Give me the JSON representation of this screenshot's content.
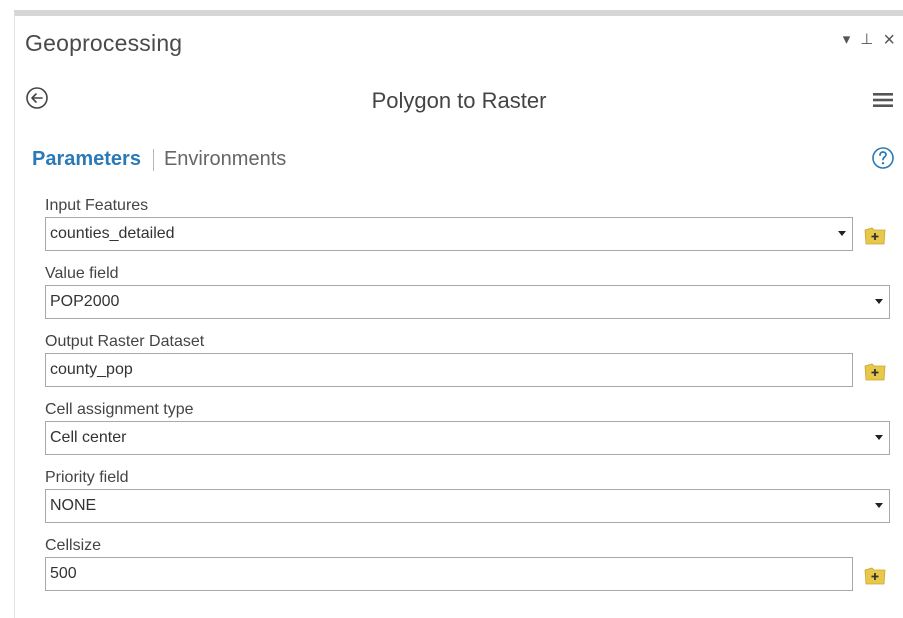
{
  "pane": {
    "title": "Geoprocessing",
    "controls": {
      "dropdown": "▾",
      "pin": "⊥",
      "close": "×"
    }
  },
  "tool": {
    "title": "Polygon to Raster",
    "back_icon": "back-arrow-icon",
    "menu_icon": "hamburger-menu-icon"
  },
  "tabs": {
    "parameters": "Parameters",
    "environments": "Environments",
    "help_icon": "help-icon"
  },
  "params": [
    {
      "label": "Input Features",
      "value": "counties_detailed",
      "type": "dropdown",
      "browse": true
    },
    {
      "label": "Value field",
      "value": "POP2000",
      "type": "dropdown",
      "browse": false
    },
    {
      "label": "Output Raster Dataset",
      "value": "county_pop",
      "type": "text",
      "browse": true
    },
    {
      "label": "Cell assignment type",
      "value": "Cell center",
      "type": "dropdown",
      "browse": false
    },
    {
      "label": "Priority field",
      "value": "NONE",
      "type": "dropdown",
      "browse": false
    },
    {
      "label": "Cellsize",
      "value": "500",
      "type": "text",
      "browse": true
    }
  ],
  "colors": {
    "accent": "#2a7ab8",
    "folder_icon": "#e8c84a"
  }
}
